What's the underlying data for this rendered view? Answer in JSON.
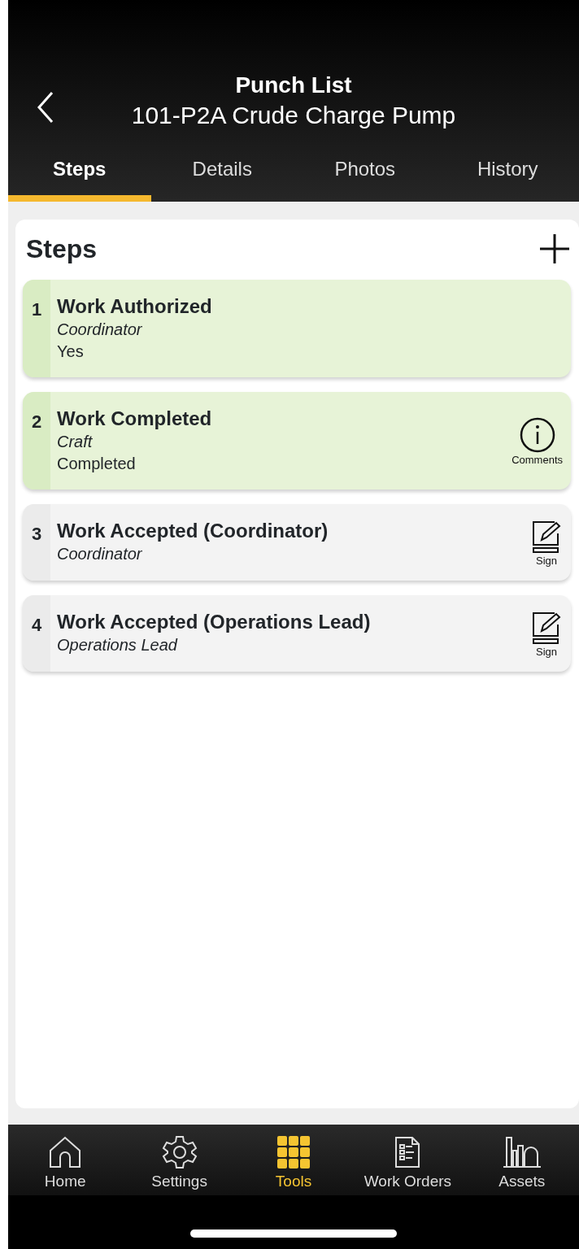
{
  "header": {
    "title": "Punch List",
    "subtitle": "101-P2A Crude Charge Pump"
  },
  "tabs": [
    {
      "label": "Steps",
      "selected": true
    },
    {
      "label": "Details",
      "selected": false
    },
    {
      "label": "Photos",
      "selected": false
    },
    {
      "label": "History",
      "selected": false
    }
  ],
  "steps_panel": {
    "title": "Steps"
  },
  "steps": [
    {
      "number": "1",
      "title": "Work Authorized",
      "role": "Coordinator",
      "value": "Yes",
      "completed": true
    },
    {
      "number": "2",
      "title": "Work Completed",
      "role": "Craft",
      "value": "Completed",
      "completed": true,
      "action": {
        "kind": "comments",
        "label": "Comments"
      }
    },
    {
      "number": "3",
      "title": "Work Accepted (Coordinator)",
      "role": "Coordinator",
      "completed": false,
      "action": {
        "kind": "sign",
        "label": "Sign"
      }
    },
    {
      "number": "4",
      "title": "Work Accepted (Operations Lead)",
      "role": "Operations Lead",
      "completed": false,
      "action": {
        "kind": "sign",
        "label": "Sign"
      }
    }
  ],
  "bottom_nav": [
    {
      "kind": "home",
      "label": "Home",
      "selected": false
    },
    {
      "kind": "settings",
      "label": "Settings",
      "selected": false
    },
    {
      "kind": "tools",
      "label": "Tools",
      "selected": true
    },
    {
      "kind": "orders",
      "label": "Work Orders",
      "selected": false
    },
    {
      "kind": "assets",
      "label": "Assets",
      "selected": false
    }
  ]
}
